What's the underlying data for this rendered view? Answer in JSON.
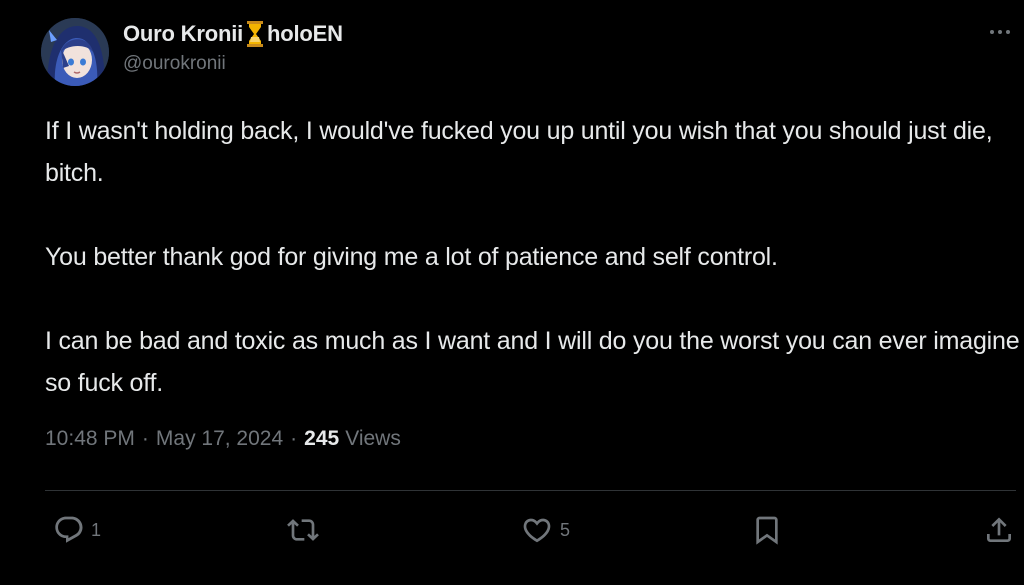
{
  "author": {
    "display_name": "Ouro Kronii",
    "badge_icon": "hourglass-icon",
    "affiliation": "holoEN",
    "handle": "@ourokronii"
  },
  "tweet": {
    "paragraphs": [
      "If I wasn't holding back, I would've fucked you up until you wish that you should just die, bitch.",
      "You better thank god for giving me a lot of patience and self control.",
      "I can be bad and toxic as much as I want and I will do you the worst you can ever imagine so fuck off."
    ],
    "time": "10:48 PM",
    "date": "May 17, 2024",
    "separator": "·",
    "views_count": "245",
    "views_label": "Views"
  },
  "actions": {
    "reply_count": "1",
    "repost_count": "",
    "like_count": "5"
  },
  "colors": {
    "background": "#000000",
    "text_primary": "#e7e9ea",
    "text_secondary": "#71767b",
    "divider": "#2f3336",
    "hourglass": "#f4b400"
  }
}
